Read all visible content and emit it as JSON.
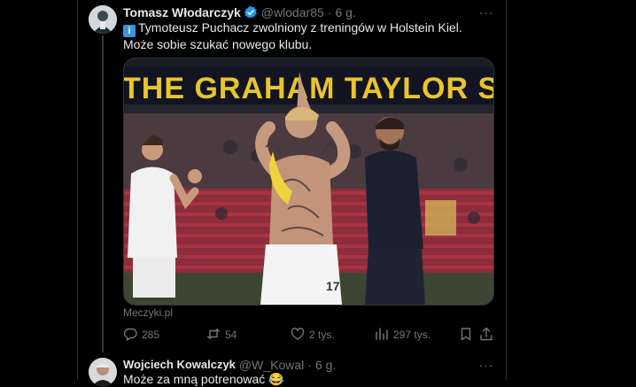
{
  "tweet": {
    "author_name": "Tomasz Włodarczyk",
    "handle": "@wlodar85",
    "separator": "·",
    "time": "6 g.",
    "more_label": "···",
    "info_badge": "i",
    "text": "Tymoteusz Puchacz zwolniony z treningów w Holstein Kiel. Może sobie szukać nowego klubu.",
    "media": {
      "stadium_banner_text": "THE GRAHAM TAYLOR S",
      "jersey_number": "17"
    },
    "source": "Meczyki.pl",
    "stats": {
      "replies": "285",
      "retweets": "54",
      "likes": "2 tys.",
      "views": "297 tys."
    },
    "icons": [
      "reply-icon",
      "retweet-icon",
      "like-icon",
      "views-icon",
      "bookmark-icon",
      "share-icon"
    ]
  },
  "reply": {
    "author_name": "Wojciech Kowalczyk",
    "handle": "@W_Kowal",
    "separator": "·",
    "time": "6 g.",
    "more_label": "···",
    "text": "Może za mną potrenować 😂"
  },
  "colors": {
    "background": "#000000",
    "text": "#e7e9ea",
    "muted": "#71767b",
    "verified": "#1d9bf0",
    "border": "#2f3336"
  }
}
